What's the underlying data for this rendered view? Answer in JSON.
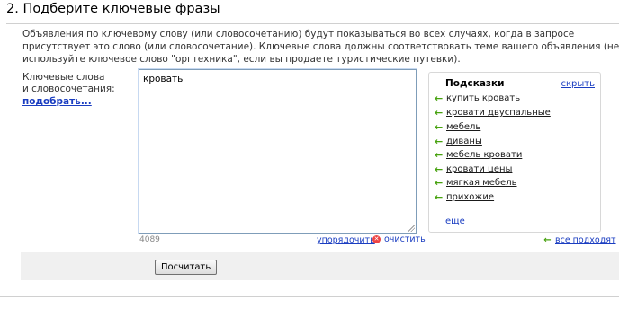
{
  "section": {
    "title": "2. Подберите ключевые фразы",
    "description": "Объявления по ключевому слову (или словосочетанию) будут показываться во всех случаях, когда в запросе присутствует это слово (или словосочетание). Ключевые слова должны соответствовать теме вашего объявления (не используйте ключевое слово \"оргтехника\", если вы продаете туристические путевки)."
  },
  "keywords": {
    "label_line1": "Ключевые слова",
    "label_line2": "и словосочетания:",
    "pick_link": "подобрать...",
    "value": "кровать",
    "counter": "4089",
    "sort_link": "упорядочить",
    "clear_link": "очистить"
  },
  "hints": {
    "title": "Подсказки",
    "hide_link": "скрыть",
    "items": [
      "купить кровать",
      "кровати двуспальные",
      "мебель",
      "диваны",
      "мебель кровати",
      "кровати цены",
      "мягкая мебель",
      "прихожие"
    ],
    "more_link": "еще",
    "all_fit_link": "все подходят"
  },
  "footer": {
    "calc_button": "Посчитать"
  },
  "colors": {
    "link": "#1a3dc1",
    "arrow": "#47a20f",
    "clear_icon": "#e44444"
  },
  "icons": {
    "hint_arrow": "left-arrow-icon",
    "clear": "clear-icon"
  }
}
